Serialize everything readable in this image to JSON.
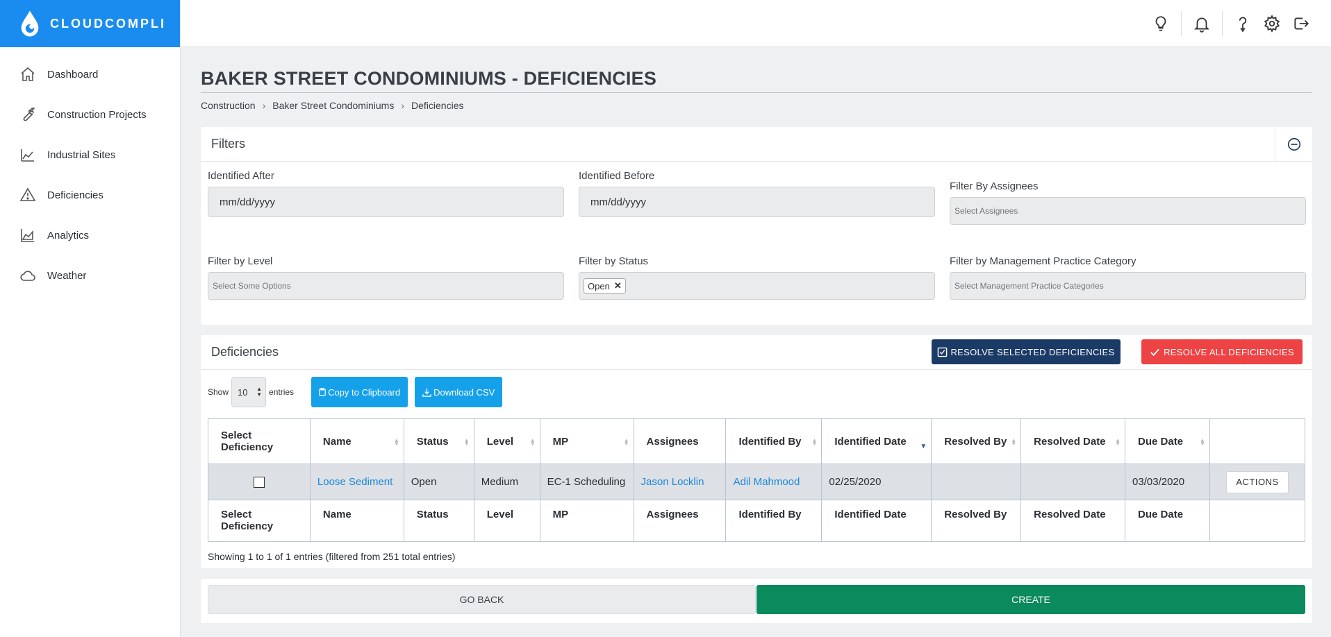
{
  "brand": {
    "name": "CLOUDCOMPLI",
    "color": "#1a8cf0"
  },
  "sidebar": {
    "items": [
      {
        "label": "Dashboard",
        "icon": "home-icon"
      },
      {
        "label": "Construction Projects",
        "icon": "wrench-icon"
      },
      {
        "label": "Industrial Sites",
        "icon": "factory-icon"
      },
      {
        "label": "Deficiencies",
        "icon": "warning-icon"
      },
      {
        "label": "Analytics",
        "icon": "area-chart-icon"
      },
      {
        "label": "Weather",
        "icon": "cloud-icon"
      }
    ]
  },
  "header": {
    "icons": [
      "lightbulb-icon",
      "bell-icon",
      "help-icon",
      "gear-icon",
      "logout-icon"
    ]
  },
  "page": {
    "title": "BAKER STREET CONDOMINIUMS - DEFICIENCIES",
    "breadcrumb": [
      "Construction",
      "Baker Street Condominiums",
      "Deficiencies"
    ]
  },
  "filters": {
    "title": "Filters",
    "identified_after": {
      "label": "Identified After",
      "value": "mm/dd/yyyy"
    },
    "identified_before": {
      "label": "Identified Before",
      "value": "mm/dd/yyyy"
    },
    "assignees": {
      "label": "Filter By Assignees",
      "placeholder": "Select Assignees"
    },
    "level": {
      "label": "Filter by Level",
      "placeholder": "Select Some Options"
    },
    "status": {
      "label": "Filter by Status",
      "selected": [
        "Open"
      ],
      "remove_glyph": "✕"
    },
    "mp_category": {
      "label": "Filter by Management Practice Category",
      "placeholder": "Select Management Practice Categories"
    }
  },
  "deficiencies": {
    "title": "Deficiencies",
    "resolve_selected_label": "RESOLVE SELECTED DEFICIENCIES",
    "resolve_all_label": "RESOLVE ALL DEFICIENCIES",
    "show_label": "Show",
    "entries_label": "entries",
    "page_length": "10",
    "copy_label": "Copy to Clipboard",
    "csv_label": "Download CSV",
    "columns": [
      "Select Deficiency",
      "Name",
      "Status",
      "Level",
      "MP",
      "Assignees",
      "Identified By",
      "Identified Date",
      "Resolved By",
      "Resolved Date",
      "Due Date",
      ""
    ],
    "rows": [
      {
        "name": "Loose Sediment",
        "status": "Open",
        "level": "Medium",
        "mp": "EC-1 Scheduling",
        "assignees": "Jason Locklin",
        "identified_by": "Adil Mahmood",
        "identified_date": "02/25/2020",
        "resolved_by": "",
        "resolved_date": "",
        "due_date": "03/03/2020",
        "actions_label": "ACTIONS"
      }
    ],
    "info": "Showing 1 to 1 of 1 entries (filtered from 251 total entries)"
  },
  "footer": {
    "back_label": "GO BACK",
    "create_label": "CREATE"
  }
}
